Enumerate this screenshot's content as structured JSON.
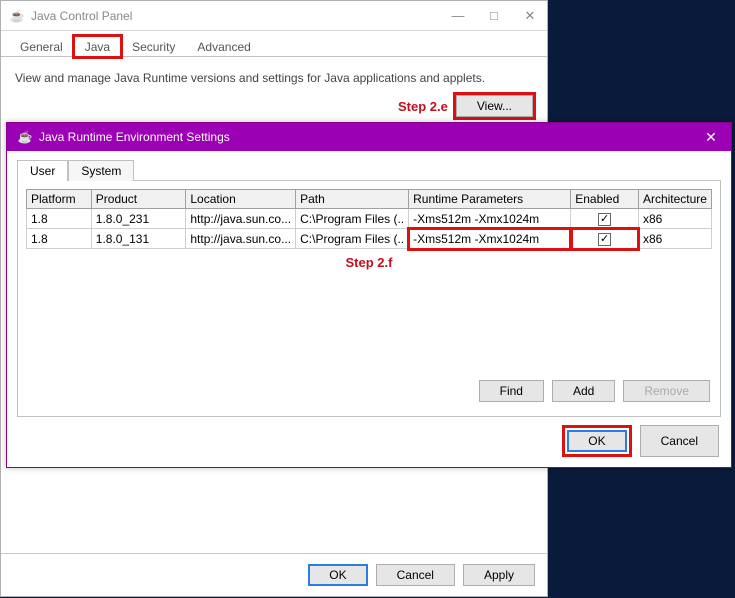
{
  "jcp": {
    "title": "Java Control Panel",
    "tabs": [
      "General",
      "Java",
      "Security",
      "Advanced"
    ],
    "active_tab": "Java",
    "desc": "View and manage Java Runtime versions and settings for Java applications and applets.",
    "view_btn": "View...",
    "step_view": "Step 2.e",
    "footer": {
      "ok": "OK",
      "cancel": "Cancel",
      "apply": "Apply"
    }
  },
  "jre": {
    "title": "Java Runtime Environment Settings",
    "tabs": [
      "User",
      "System"
    ],
    "active_tab": "User",
    "columns": [
      "Platform",
      "Product",
      "Location",
      "Path",
      "Runtime Parameters",
      "Enabled",
      "Architecture"
    ],
    "rows": [
      {
        "platform": "1.8",
        "product": "1.8.0_231",
        "location": "http://java.sun.co...",
        "path": "C:\\Program Files (..",
        "runtime": "-Xms512m -Xmx1024m",
        "enabled": true,
        "arch": "x86"
      },
      {
        "platform": "1.8",
        "product": "1.8.0_131",
        "location": "http://java.sun.co...",
        "path": "C:\\Program Files (..",
        "runtime": "-Xms512m -Xmx1024m",
        "enabled": true,
        "arch": "x86"
      }
    ],
    "step_row": "Step 2.f",
    "buttons": {
      "find": "Find",
      "add": "Add",
      "remove": "Remove"
    },
    "footer": {
      "ok": "OK",
      "cancel": "Cancel"
    }
  },
  "icons": {
    "java": "☕",
    "minimize": "—",
    "maximize": "□",
    "close": "✕",
    "check": "✓"
  }
}
